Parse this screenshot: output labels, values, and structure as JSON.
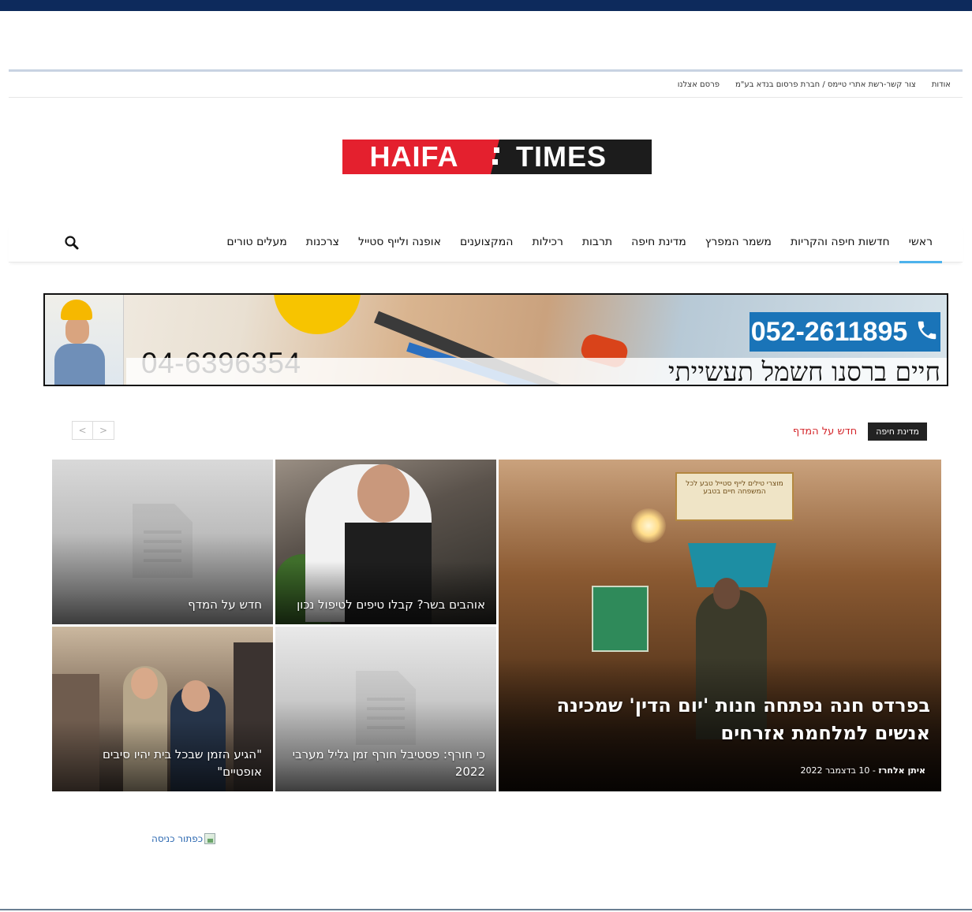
{
  "topbar": {
    "links": [
      "אודות",
      "צור קשר-רשת אתרי טיימס / חברת פרסום בנדא בע\"מ",
      "פרסם אצלנו"
    ]
  },
  "logo": {
    "left": "HAIFA",
    "right": "TIMES"
  },
  "nav": {
    "items": [
      "ראשי",
      "חדשות חיפה והקריות",
      "משמר המפרץ",
      "מדינת חיפה",
      "תרבות",
      "רכילות",
      "המקצוענים",
      "אופנה ולייף סטייל",
      "צרכנות",
      "מעלים טורים"
    ],
    "active_index": 0,
    "search_icon": "search-icon"
  },
  "ad_banner": {
    "phone_left": "04-6396354",
    "phone_right": "052-2611895",
    "name_text": "חיים ברסנו חשמל תעשייתי",
    "phone_icon": "phone-icon"
  },
  "block": {
    "category_tag": "מדינת חיפה",
    "title": "חדש על המדף",
    "prev_label": "<",
    "next_label": ">"
  },
  "featured": {
    "title": "בפרדס חנה נפתחה חנות 'יום הדין' שמכינה אנשים למלחמת אזרחים",
    "author": "איתן אלחרז",
    "separator": " - ",
    "date": "10 בדצמבר 2022",
    "poster_text": "מוצרי טילים לייף סטייל טבע לכל המשפחה חיים בטבע"
  },
  "tiles": [
    {
      "title": "אוהבים בשר? קבלו טיפים לטיפול נכון"
    },
    {
      "title": "חדש על המדף"
    },
    {
      "title": "כי חורף: פסטיבל חורף זמן גליל מערבי 2022"
    },
    {
      "title": "\"הגיע הזמן שבכל בית יהיו סיבים אופטיים\""
    }
  ],
  "promo": {
    "alt_text": "כפתור כניסה"
  },
  "colors": {
    "brand_red": "#e4202e",
    "accent_blue": "#4db2ec",
    "top_strip": "#0d2a5c",
    "block_title_red": "#d4252a"
  }
}
